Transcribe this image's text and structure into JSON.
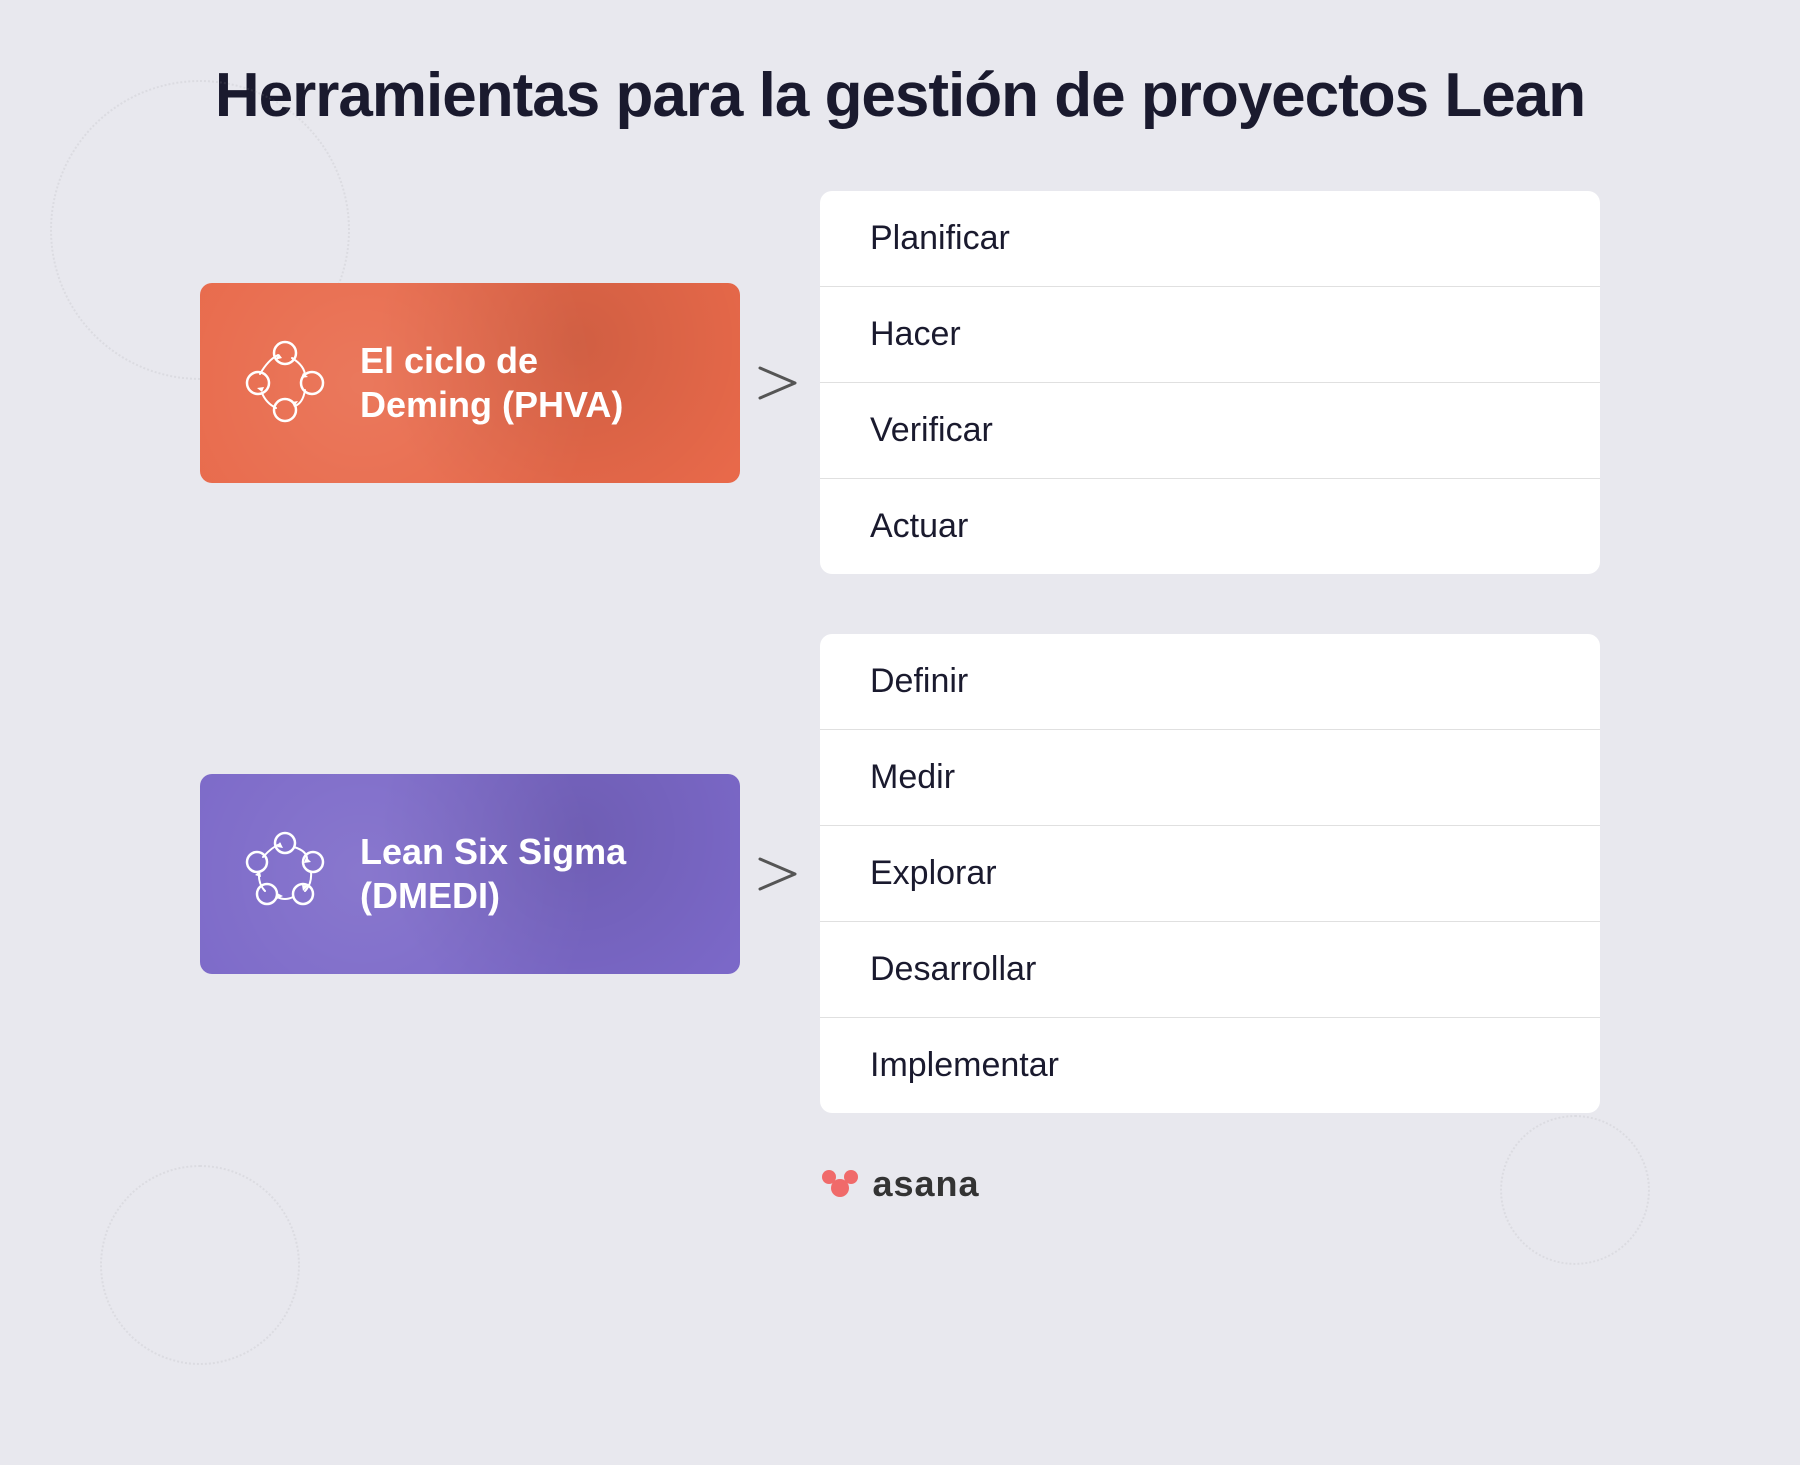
{
  "page": {
    "title": "Herramientas para la gestión de proyectos Lean",
    "background_color": "#e8e8ee"
  },
  "tools": [
    {
      "id": "phva",
      "card_color": "#e8694a",
      "icon_type": "cycle-icon",
      "label_line1": "El ciclo de",
      "label_line2": "Deming (PHVA)",
      "items": [
        "Planificar",
        "Hacer",
        "Verificar",
        "Actuar"
      ]
    },
    {
      "id": "dmedi",
      "card_color": "#7b68c8",
      "icon_type": "cycle-icon",
      "label_line1": "Lean Six Sigma",
      "label_line2": "(DMEDI)",
      "items": [
        "Definir",
        "Medir",
        "Explorar",
        "Desarrollar",
        "Implementar"
      ]
    }
  ],
  "logo": {
    "text": "asana"
  }
}
